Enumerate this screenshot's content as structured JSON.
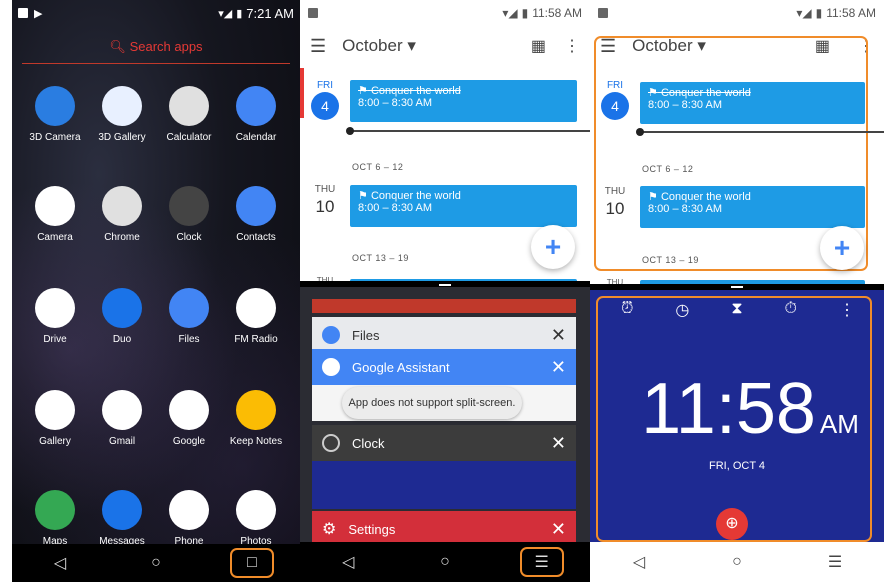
{
  "colors": {
    "accent": "#f08c2a",
    "calendar_event": "#1e9be5",
    "clock_bg": "#1e2a92",
    "search_red": "#e53935"
  },
  "launcher": {
    "status_time": "7:21 AM",
    "search_placeholder": "Search apps",
    "apps": [
      {
        "label": "3D Camera",
        "icon": "3d-camera-icon",
        "color": "#2a7de1"
      },
      {
        "label": "3D Gallery",
        "icon": "3d-gallery-icon",
        "color": "#e8f0ff"
      },
      {
        "label": "Calculator",
        "icon": "calculator-icon",
        "color": "#e0e0e0"
      },
      {
        "label": "Calendar",
        "icon": "calendar-icon",
        "color": "#4285f4"
      },
      {
        "label": "Camera",
        "icon": "camera-icon",
        "color": "#ffffff"
      },
      {
        "label": "Chrome",
        "icon": "chrome-icon",
        "color": "#e0e0e0"
      },
      {
        "label": "Clock",
        "icon": "clock-icon",
        "color": "#444"
      },
      {
        "label": "Contacts",
        "icon": "contacts-icon",
        "color": "#4285f4"
      },
      {
        "label": "Drive",
        "icon": "drive-icon",
        "color": "#ffffff"
      },
      {
        "label": "Duo",
        "icon": "duo-icon",
        "color": "#1a73e8"
      },
      {
        "label": "Files",
        "icon": "files-icon",
        "color": "#4285f4"
      },
      {
        "label": "FM Radio",
        "icon": "fm-radio-icon",
        "color": "#ffffff"
      },
      {
        "label": "Gallery",
        "icon": "gallery-icon",
        "color": "#ffffff"
      },
      {
        "label": "Gmail",
        "icon": "gmail-icon",
        "color": "#ffffff"
      },
      {
        "label": "Google",
        "icon": "google-icon",
        "color": "#ffffff"
      },
      {
        "label": "Keep Notes",
        "icon": "keep-notes-icon",
        "color": "#fbbc04"
      },
      {
        "label": "Maps",
        "icon": "maps-icon",
        "color": "#34a853"
      },
      {
        "label": "Messages",
        "icon": "messages-icon",
        "color": "#1a73e8"
      },
      {
        "label": "Phone",
        "icon": "phone-icon",
        "color": "#ffffff"
      },
      {
        "label": "Photos",
        "icon": "photos-icon",
        "color": "#ffffff"
      }
    ]
  },
  "calendar": {
    "status_time": "11:58 AM",
    "month": "October",
    "day1_name": "FRI",
    "day1_num": "4",
    "event_title": "Conquer the world",
    "event_time": "8:00 – 8:30 AM",
    "week1": "OCT 6 – 12",
    "day2_name": "THU",
    "day2_num": "10",
    "week2": "OCT 13 – 19",
    "day3_name": "THU",
    "fab": "+"
  },
  "recents": {
    "cards": [
      {
        "label": "Files",
        "icon": "files-icon"
      },
      {
        "label": "Google Assistant",
        "icon": "google-assistant-icon"
      },
      {
        "label": "Clock",
        "icon": "clock-icon"
      },
      {
        "label": "Settings",
        "icon": "settings-icon"
      }
    ],
    "toast": "App does not support split-screen.",
    "close": "✕"
  },
  "clock": {
    "time": "11:58",
    "ampm": "AM",
    "date": "FRI, OCT 4"
  }
}
